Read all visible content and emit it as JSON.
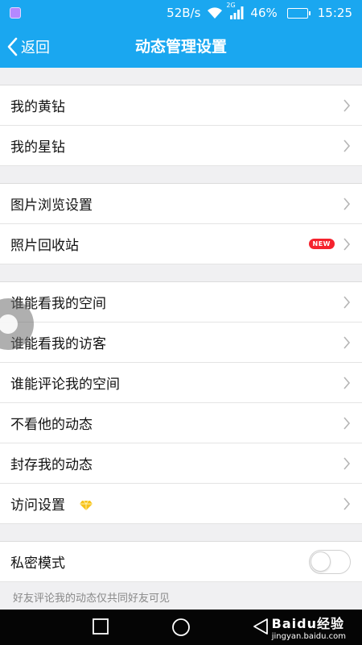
{
  "status_bar": {
    "network_speed": "52B/s",
    "network_type": "2G",
    "battery_percent": "46%",
    "battery_level": 0.46,
    "time": "15:25",
    "icons": [
      "app-icon",
      "wifi-icon",
      "signal-icon",
      "battery-icon"
    ]
  },
  "nav": {
    "back_label": "返回",
    "title": "动态管理设置"
  },
  "sections": [
    {
      "rows": [
        {
          "label": "我的黄钻"
        },
        {
          "label": "我的星钻"
        }
      ]
    },
    {
      "rows": [
        {
          "label": "图片浏览设置"
        },
        {
          "label": "照片回收站",
          "badge": "NEW"
        }
      ]
    },
    {
      "rows": [
        {
          "label": "谁能看我的空间"
        },
        {
          "label": "谁能看我的访客"
        },
        {
          "label": "谁能评论我的空间"
        },
        {
          "label": "不看他的动态"
        },
        {
          "label": "封存我的动态"
        },
        {
          "label": "访问设置",
          "icon": "yellow-diamond-icon"
        }
      ]
    },
    {
      "rows": [
        {
          "label": "私密模式",
          "toggle": false
        }
      ],
      "note": "好友评论我的动态仅共同好友可见"
    }
  ],
  "watermark": {
    "brand": "Baidu经验",
    "url": "jingyan.baidu.com"
  },
  "colors": {
    "accent": "#1aa7f0",
    "badge_red": "#f5222d",
    "diamond": "#f7c21a"
  }
}
